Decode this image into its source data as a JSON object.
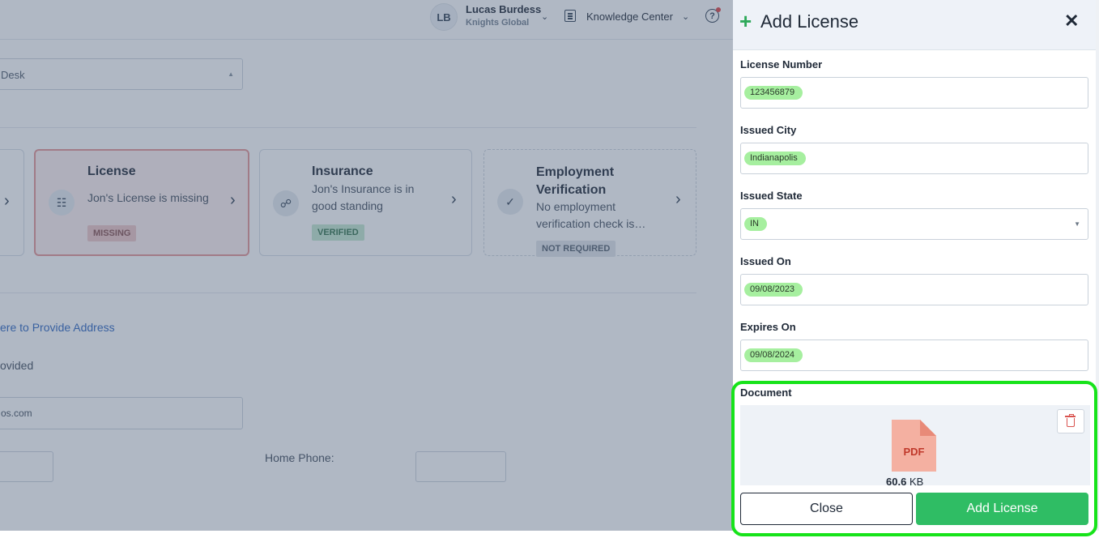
{
  "topbar": {
    "avatar_initials": "LB",
    "user_name": "Lucas Burdess",
    "user_org": "Knights Global",
    "knowledge_center": "Knowledge Center",
    "help_glyph": "?"
  },
  "background": {
    "desk_value": "Desk",
    "cards": [
      {
        "title": "License",
        "description": "Jon's License is missing",
        "status": "MISSING"
      },
      {
        "title": "Insurance",
        "description": "Jon's Insurance is in good standing",
        "status": "VERIFIED"
      },
      {
        "title": "Employment Verification",
        "description": "No employment verification check is…",
        "status": "NOT REQUIRED"
      }
    ],
    "address_link": "ere to Provide Address",
    "provided_text": "ovided",
    "email_value": "os.com",
    "home_phone_label": "Home Phone:"
  },
  "panel": {
    "title": "Add License",
    "fields": {
      "license_number": {
        "label": "License Number",
        "value": "123456879"
      },
      "issued_city": {
        "label": "Issued City",
        "value": "Indianapolis"
      },
      "issued_state": {
        "label": "Issued State",
        "value": "IN"
      },
      "issued_on": {
        "label": "Issued On",
        "value": "09/08/2023"
      },
      "expires_on": {
        "label": "Expires On",
        "value": "09/08/2024"
      }
    },
    "document": {
      "label": "Document",
      "file_type": "PDF",
      "size_number": "60.6",
      "size_unit": "KB"
    },
    "buttons": {
      "close": "Close",
      "add": "Add License"
    }
  },
  "colors": {
    "accent_green": "#2fbd64",
    "highlight_green": "#a6ef9f",
    "outline_green": "#17e31a",
    "missing_red": "#e79a9a"
  },
  "icons": [
    "avatar",
    "chevron-down-icon",
    "book-icon",
    "help-icon",
    "plus-icon",
    "close-icon",
    "trash-icon",
    "pdf-file-icon",
    "id-card-icon",
    "shield-doc-icon",
    "check-circle-icon",
    "chevron-right-icon"
  ]
}
